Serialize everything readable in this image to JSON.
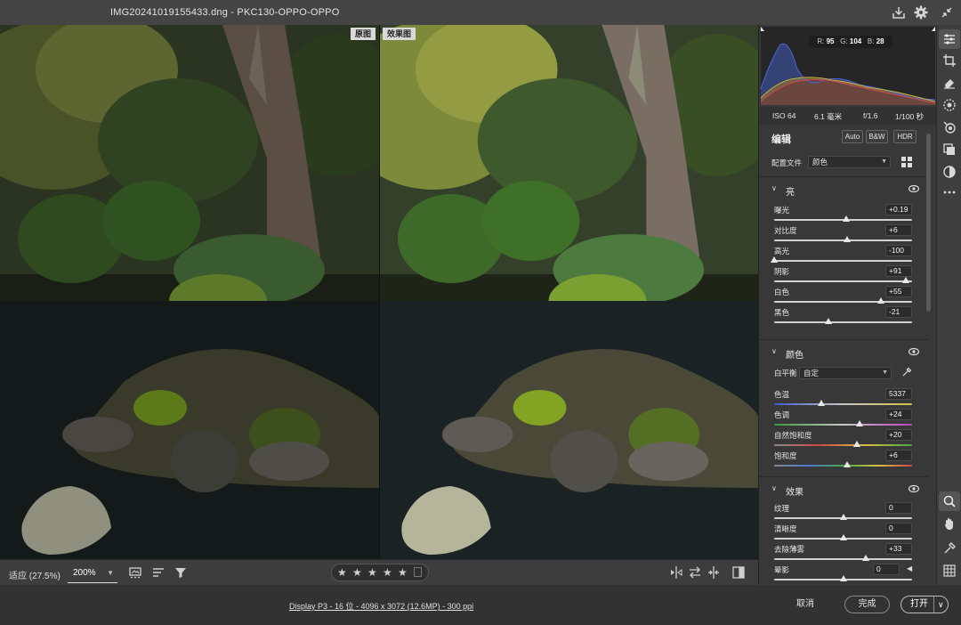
{
  "window": {
    "title": "IMG20241019155433.dng  -  PKC130-OPPO-OPPO"
  },
  "viewer": {
    "before_label": "原图",
    "after_label": "效果图"
  },
  "toolbar": {
    "fit_label": "适应 (27.5%)",
    "zoom_value": "200%",
    "stars": [
      "★",
      "★",
      "★",
      "★",
      "★"
    ]
  },
  "histogram": {
    "r_label": "R:",
    "r_value": "95",
    "g_label": "G:",
    "g_value": "104",
    "b_label": "B:",
    "b_value": "28"
  },
  "exif": {
    "iso": "ISO 64",
    "focal": "6.1 毫米",
    "aperture": "f/1.6",
    "shutter": "1/100 秒"
  },
  "edit": {
    "title": "编辑",
    "auto": "Auto",
    "bw": "B&W",
    "hdr": "HDR",
    "profile_label": "配置文件",
    "profile_value": "颜色"
  },
  "light": {
    "title": "亮",
    "rows": [
      {
        "label": "曝光",
        "value": "+0.19",
        "pos": 0.52
      },
      {
        "label": "对比度",
        "value": "+6",
        "pos": 0.53
      },
      {
        "label": "高光",
        "value": "-100",
        "pos": 0.0
      },
      {
        "label": "阴影",
        "value": "+91",
        "pos": 0.955
      },
      {
        "label": "白色",
        "value": "+55",
        "pos": 0.775
      },
      {
        "label": "黑色",
        "value": "-21",
        "pos": 0.395
      }
    ]
  },
  "color": {
    "title": "颜色",
    "wb_label": "白平衡",
    "wb_value": "自定",
    "rows": [
      {
        "label": "色温",
        "value": "5337",
        "pos": 0.34
      },
      {
        "label": "色调",
        "value": "+24",
        "pos": 0.62
      },
      {
        "label": "自然饱和度",
        "value": "+20",
        "pos": 0.6
      },
      {
        "label": "饱和度",
        "value": "+6",
        "pos": 0.53
      }
    ]
  },
  "effects": {
    "title": "效果",
    "rows": [
      {
        "label": "纹理",
        "value": "0",
        "pos": 0.5
      },
      {
        "label": "清晰度",
        "value": "0",
        "pos": 0.5
      },
      {
        "label": "去除薄雾",
        "value": "+33",
        "pos": 0.665
      },
      {
        "label": "晕影",
        "value": "0",
        "pos": 0.5
      }
    ]
  },
  "status": {
    "file_info": "Display P3 - 16 位 - 4096 x 3072 (12.6MP) - 300 ppi",
    "cancel": "取消",
    "done": "完成",
    "open": "打开"
  },
  "colors": {
    "panel": "#383838",
    "accent": "#e8e8e8"
  }
}
